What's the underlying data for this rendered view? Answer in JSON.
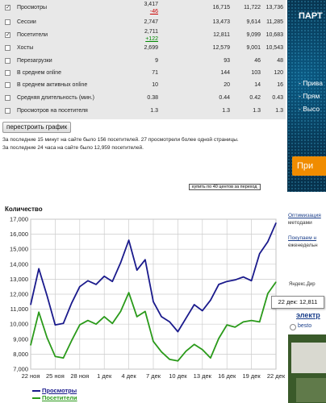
{
  "stats": {
    "rows": [
      {
        "checked": true,
        "label": "Просмотры",
        "c1": "3,417",
        "c1_delta": "-46",
        "c1_delta_type": "neg",
        "c2": "16,715",
        "c3": "11,722",
        "c4": "13,736"
      },
      {
        "checked": false,
        "label": "Сессии",
        "c1": "2,747",
        "c2": "13,473",
        "c3": "9,614",
        "c4": "11,285"
      },
      {
        "checked": true,
        "label": "Посетители",
        "c1": "2,711",
        "c1_delta": "+122",
        "c1_delta_type": "pos",
        "c2": "12,811",
        "c3": "9,099",
        "c4": "10,683"
      },
      {
        "checked": false,
        "label": "Хосты",
        "c1": "2,699",
        "c2": "12,579",
        "c3": "9,001",
        "c4": "10,543"
      },
      {
        "checked": false,
        "label": "Перезагрузки",
        "c1": "9",
        "c2": "93",
        "c3": "46",
        "c4": "48"
      },
      {
        "checked": false,
        "label": "В среднем online",
        "c1": "71",
        "c2": "144",
        "c3": "103",
        "c4": "120"
      },
      {
        "checked": false,
        "label": "В среднем активных online",
        "c1": "10",
        "c2": "20",
        "c3": "14",
        "c4": "16"
      },
      {
        "checked": false,
        "label": "Средняя длительность (мин.)",
        "c1": "0.38",
        "c2": "0.44",
        "c3": "0.42",
        "c4": "0.43"
      },
      {
        "checked": false,
        "label": "Просмотров на посетителя",
        "c1": "1.3",
        "c2": "1.3",
        "c3": "1.3",
        "c4": "1.3"
      }
    ]
  },
  "redraw_button": "перестроить график",
  "notes": {
    "line1": "За последние 15 минут на сайте было 156 посетителей. 27 просмотрели более одной страницы.",
    "line2": "За последние 24 часа на сайте было 12,959 посетителей."
  },
  "buy_link": "купить по 40 центов за переход",
  "chart_title": "Количество",
  "tooltip": "22 дек: 12,811",
  "colors": {
    "views": "#1a1a8c",
    "visitors": "#2a9a1a"
  },
  "chart_data": {
    "type": "line",
    "x": [
      "22 ноя",
      "23 ноя",
      "24 ноя",
      "25 ноя",
      "26 ноя",
      "27 ноя",
      "28 ноя",
      "29 ноя",
      "30 ноя",
      "1 дек",
      "2 дек",
      "3 дек",
      "4 дек",
      "5 дек",
      "6 дек",
      "7 дек",
      "8 дек",
      "9 дек",
      "10 дек",
      "11 дек",
      "12 дек",
      "13 дек",
      "14 дек",
      "15 дек",
      "16 дек",
      "17 дек",
      "18 дек",
      "19 дек",
      "20 дек",
      "21 дек",
      "22 дек"
    ],
    "x_tick_labels": [
      "22 ноя",
      "25 ноя",
      "28 ноя",
      "1 дек",
      "4 дек",
      "7 дек",
      "10 дек",
      "13 дек",
      "16 дек",
      "19 дек",
      "22 дек"
    ],
    "series": [
      {
        "name": "Просмотры",
        "values": [
          11300,
          13700,
          11900,
          9950,
          10050,
          11400,
          12500,
          12900,
          12650,
          13200,
          12850,
          14100,
          15600,
          13600,
          14300,
          11500,
          10500,
          10150,
          9500,
          10400,
          11300,
          10900,
          11600,
          12650,
          12850,
          12950,
          13150,
          12900,
          14700,
          15500,
          16750
        ]
      },
      {
        "name": "Посетители",
        "values": [
          8600,
          10800,
          9100,
          7850,
          7750,
          8900,
          9950,
          10250,
          10000,
          10500,
          10050,
          10850,
          12100,
          10500,
          10850,
          8850,
          8150,
          7650,
          7550,
          8200,
          8650,
          8300,
          7750,
          9050,
          9950,
          9800,
          10150,
          10250,
          10150,
          12050,
          12811
        ]
      }
    ],
    "ylim": [
      7000,
      17000
    ],
    "yticks": [
      "7,000",
      "8,000",
      "9,000",
      "10,000",
      "11,000",
      "12,000",
      "13,000",
      "14,000",
      "15,000",
      "16,000",
      "17,000"
    ],
    "grid": true
  },
  "banner": {
    "heading": "ПАРТ",
    "items": [
      "- Прива",
      "- Прям",
      "- Высо"
    ],
    "button": "При"
  },
  "ads": {
    "link1a": "Оптимизация",
    "link1b": "методами",
    "link2a": "Покупаем н",
    "link2b": "еженедельн",
    "yandex_label": "Яндекс.Дир",
    "electr": "электр",
    "besto": "besto"
  }
}
